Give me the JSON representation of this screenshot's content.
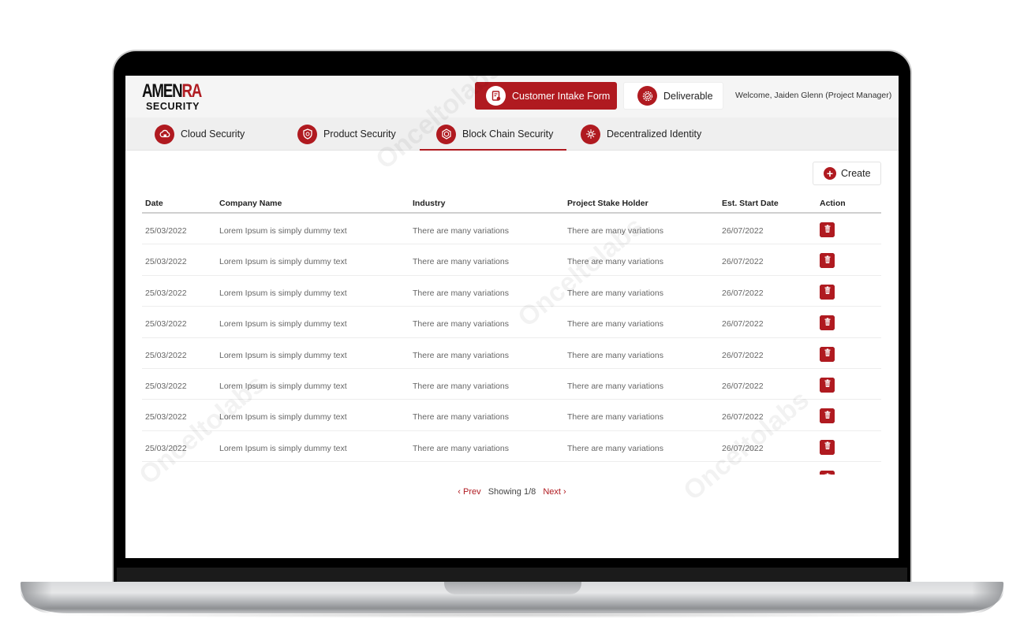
{
  "brand": {
    "name_part1": "AMEN",
    "name_part2": "RA",
    "subtitle": "SECURITY",
    "accent_color": "#b01a20"
  },
  "header": {
    "primary_button": {
      "label": "Customer Intake Form",
      "icon": "form-icon"
    },
    "secondary_button": {
      "label": "Deliverable",
      "icon": "gear-check-icon"
    },
    "welcome_text": "Welcome, Jaiden Glenn (Project Manager)"
  },
  "tabs": [
    {
      "label": "Cloud Security",
      "icon": "cloud-lock-icon",
      "active": false
    },
    {
      "label": "Product Security",
      "icon": "shield-icon",
      "active": false
    },
    {
      "label": "Block Chain Security",
      "icon": "blockchain-cube-icon",
      "active": true
    },
    {
      "label": "Decentralized Identity",
      "icon": "network-icon",
      "active": false
    }
  ],
  "toolbar": {
    "create_label": "Create"
  },
  "table": {
    "columns": [
      "Date",
      "Company Name",
      "Industry",
      "Project Stake Holder",
      "Est. Start Date",
      "Action"
    ],
    "rows": [
      {
        "date": "25/03/2022",
        "company": "Lorem Ipsum is simply dummy text",
        "industry": "There are many variations",
        "stakeholder": "There are many variations",
        "start": "26/07/2022"
      },
      {
        "date": "25/03/2022",
        "company": "Lorem Ipsum is simply dummy text",
        "industry": "There are many variations",
        "stakeholder": "There are many variations",
        "start": "26/07/2022"
      },
      {
        "date": "25/03/2022",
        "company": "Lorem Ipsum is simply dummy text",
        "industry": "There are many variations",
        "stakeholder": "There are many variations",
        "start": "26/07/2022"
      },
      {
        "date": "25/03/2022",
        "company": "Lorem Ipsum is simply dummy text",
        "industry": "There are many variations",
        "stakeholder": "There are many variations",
        "start": "26/07/2022"
      },
      {
        "date": "25/03/2022",
        "company": "Lorem Ipsum is simply dummy text",
        "industry": "There are many variations",
        "stakeholder": "There are many variations",
        "start": "26/07/2022"
      },
      {
        "date": "25/03/2022",
        "company": "Lorem Ipsum is simply dummy text",
        "industry": "There are many variations",
        "stakeholder": "There are many variations",
        "start": "26/07/2022"
      },
      {
        "date": "25/03/2022",
        "company": "Lorem Ipsum is simply dummy text",
        "industry": "There are many variations",
        "stakeholder": "There are many variations",
        "start": "26/07/2022"
      },
      {
        "date": "25/03/2022",
        "company": "Lorem Ipsum is simply dummy text",
        "industry": "There are many variations",
        "stakeholder": "There are many variations",
        "start": "26/07/2022"
      },
      {
        "date": "",
        "company": "",
        "industry": "",
        "stakeholder": "",
        "start": ""
      }
    ]
  },
  "pagination": {
    "prev_label": "Prev",
    "status": "Showing 1/8",
    "next_label": "Next"
  },
  "watermark_text": "Onceltolabs"
}
